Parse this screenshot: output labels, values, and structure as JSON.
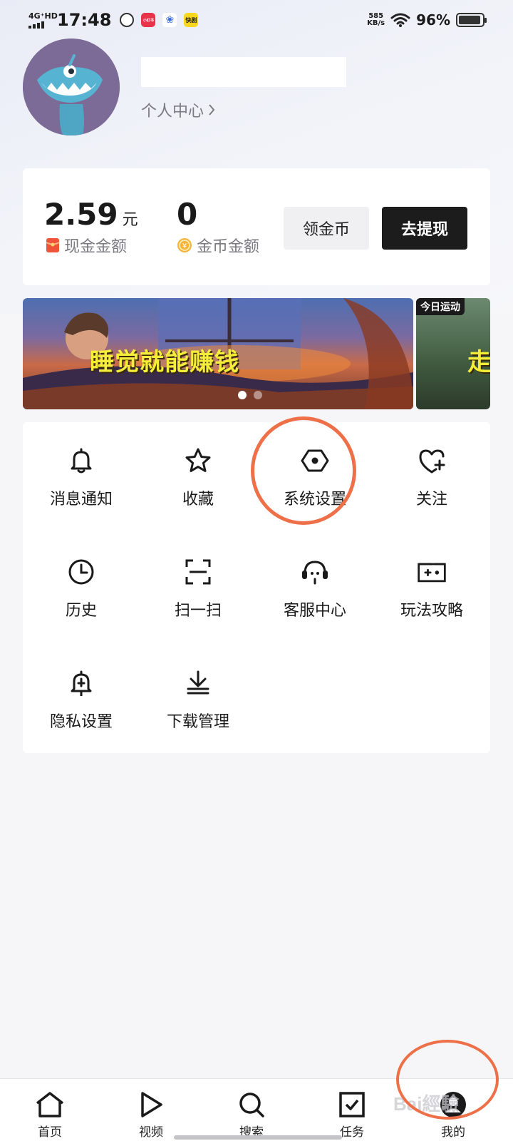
{
  "status_bar": {
    "network": "4G⁺HD",
    "time": "17:48",
    "apps": [
      "小红书",
      "快剧"
    ],
    "net_speed_value": "585",
    "net_speed_unit": "KB/s",
    "battery_percent": "96%"
  },
  "profile": {
    "personal_center_label": "个人中心",
    "name_value": ""
  },
  "wallet": {
    "cash_amount": "2.59",
    "cash_unit": "元",
    "cash_label": "现金金额",
    "coin_amount": "0",
    "coin_label": "金币金额",
    "claim_coins_label": "领金币",
    "withdraw_label": "去提现"
  },
  "banner": {
    "main_text": "睡觉就能赚钱",
    "next_tag": "今日运动",
    "next_text": "走",
    "active_dot": 0,
    "dot_count": 2
  },
  "grid": {
    "items": [
      {
        "label": "消息通知",
        "icon": "bell-icon"
      },
      {
        "label": "收藏",
        "icon": "star-icon"
      },
      {
        "label": "系统设置",
        "icon": "settings-hexagon-icon"
      },
      {
        "label": "关注",
        "icon": "heart-plus-icon"
      },
      {
        "label": "历史",
        "icon": "clock-icon"
      },
      {
        "label": "扫一扫",
        "icon": "scan-icon"
      },
      {
        "label": "客服中心",
        "icon": "headset-icon"
      },
      {
        "label": "玩法攻略",
        "icon": "gamepad-icon"
      },
      {
        "label": "隐私设置",
        "icon": "privacy-bell-icon"
      },
      {
        "label": "下载管理",
        "icon": "download-icon"
      }
    ]
  },
  "tabbar": {
    "items": [
      {
        "label": "首页",
        "icon": "home-icon"
      },
      {
        "label": "视频",
        "icon": "play-icon"
      },
      {
        "label": "搜索",
        "icon": "search-icon"
      },
      {
        "label": "任务",
        "icon": "task-check-icon"
      },
      {
        "label": "我的",
        "icon": "profile-icon"
      }
    ]
  },
  "watermark": "Bai經驗",
  "colors": {
    "accent_dark": "#1c1c1c",
    "highlight_ring": "#ee7048",
    "banner_text": "#f4ee3a",
    "page_bg": "#f6f6f8"
  }
}
